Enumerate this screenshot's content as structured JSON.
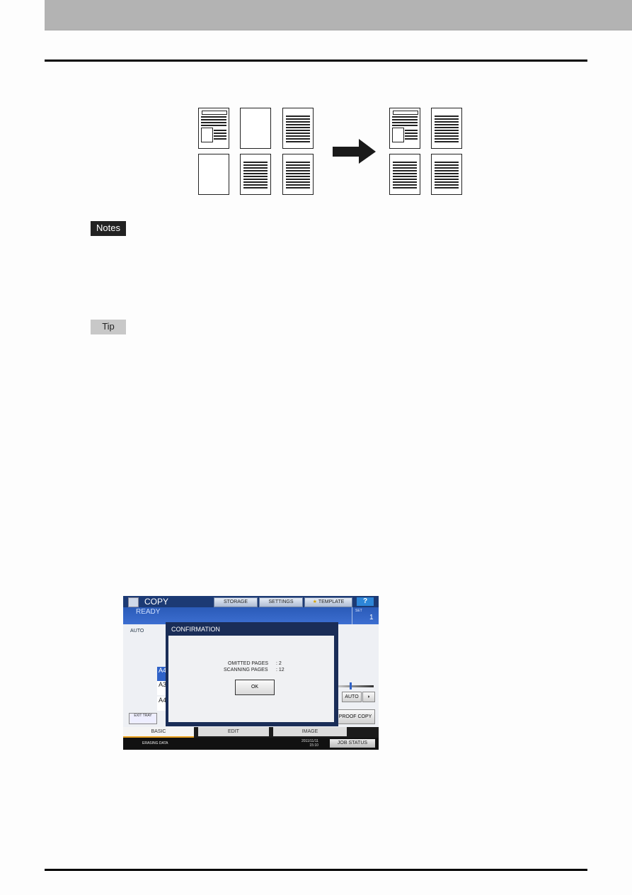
{
  "labels": {
    "notes": "Notes",
    "tip": "Tip"
  },
  "panel": {
    "title": "COPY",
    "status": "READY",
    "toolbar": {
      "storage": "STORAGE",
      "settings": "SETTINGS",
      "template": "TEMPLATE",
      "help": "?"
    },
    "set_label": "SET",
    "set_value": "1",
    "auto_label": "AUTO",
    "papers": [
      "A4",
      "A3",
      "A4"
    ],
    "exit_tray": "EXIT TRAY",
    "density_auto": "AUTO",
    "proof_copy": "PROOF COPY",
    "dialog": {
      "title": "CONFIRMATION",
      "omitted_label": "OMITTED PAGES",
      "omitted_value": ": 2",
      "scanning_label": "SCANNING PAGES",
      "scanning_value": ": 12",
      "ok": "OK"
    },
    "tabs": [
      "BASIC",
      "EDIT",
      "IMAGE"
    ],
    "footer": {
      "status": "ERASING DATA",
      "date": "2011/11/11",
      "time": "15:10",
      "job_status": "JOB STATUS"
    }
  }
}
